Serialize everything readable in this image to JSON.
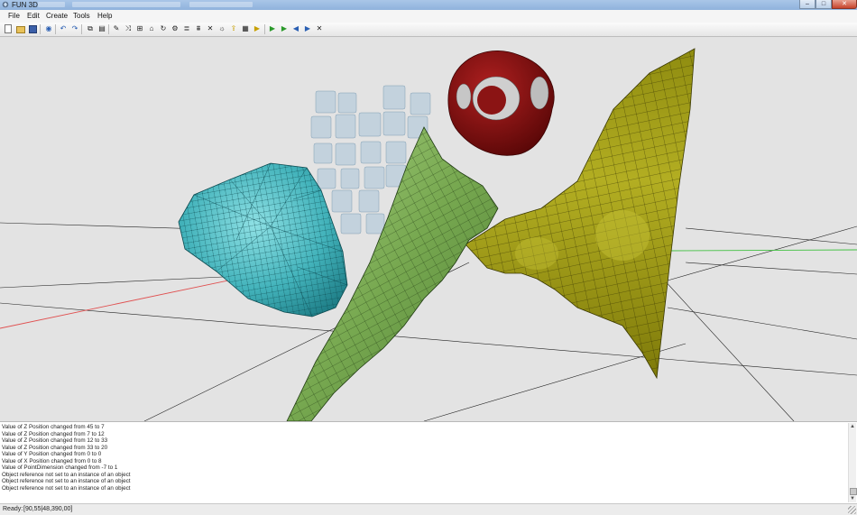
{
  "window": {
    "title": "FUN 3D",
    "controls": {
      "minimize": "‒",
      "maximize": "□",
      "close": "✕"
    }
  },
  "menu": {
    "items": [
      {
        "label": "File"
      },
      {
        "label": "Edit"
      },
      {
        "label": "Create"
      },
      {
        "label": "Tools"
      },
      {
        "label": "Help"
      }
    ]
  },
  "toolbar": {
    "buttons": [
      {
        "name": "new-icon",
        "glyph": ""
      },
      {
        "name": "open-icon",
        "glyph": ""
      },
      {
        "name": "save-icon",
        "glyph": ""
      },
      {
        "name": "globe-icon",
        "glyph": "◉"
      },
      {
        "name": "undo-icon",
        "glyph": "↶"
      },
      {
        "name": "redo-icon",
        "glyph": "↷"
      },
      {
        "name": "copy-icon",
        "glyph": "⧉"
      },
      {
        "name": "paste-icon",
        "glyph": "▤"
      },
      {
        "name": "brush-icon",
        "glyph": "✎"
      },
      {
        "name": "transform-icon",
        "glyph": "⤨"
      },
      {
        "name": "grid-icon",
        "glyph": "⊞"
      },
      {
        "name": "arch-icon",
        "glyph": "⌂"
      },
      {
        "name": "orbit-icon",
        "glyph": "↻"
      },
      {
        "name": "settings-icon",
        "glyph": "⚙"
      },
      {
        "name": "layers-icon",
        "glyph": "≣"
      },
      {
        "name": "stack-icon",
        "glyph": "⩩"
      },
      {
        "name": "delete-icon",
        "glyph": "✕"
      },
      {
        "name": "sun-icon",
        "glyph": "☼"
      },
      {
        "name": "export-icon",
        "glyph": "⇪"
      },
      {
        "name": "render-icon",
        "glyph": "▦"
      },
      {
        "name": "animation-icon",
        "glyph": "▶"
      },
      {
        "name": "play-icon",
        "glyph": "▶"
      },
      {
        "name": "step-back-icon",
        "glyph": "◀"
      },
      {
        "name": "step-forward-icon",
        "glyph": "▶"
      },
      {
        "name": "stop-icon",
        "glyph": "✕"
      }
    ]
  },
  "log": {
    "lines": [
      "Value of Z Position changed from 45 to 7",
      "Value of Z Position changed from 7 to 12",
      "Value of Z Position changed from 12 to 33",
      "Value of Z Position changed from 33 to 20",
      "Value of Y Position changed from 0 to 0",
      "Value of X Position changed from 0 to 8",
      "Value of PointDimension changed from -7 to 1",
      "Object reference not set to an instance of an object",
      "Object reference not set to an instance of an object",
      "Object reference not set to an instance of an object"
    ]
  },
  "status": {
    "text": "Ready",
    "coords": "[90,55|48,390,00]"
  },
  "colors": {
    "viewport_bg": "#e3e3e3",
    "crystal": "#3fb8c0",
    "green_surface": "#7fb55a",
    "yellow_surface": "#a8a41c",
    "red_object": "#8b1414",
    "cubes": "#a9c4d8",
    "axis_red": "#e05050",
    "axis_green": "#40c040"
  }
}
